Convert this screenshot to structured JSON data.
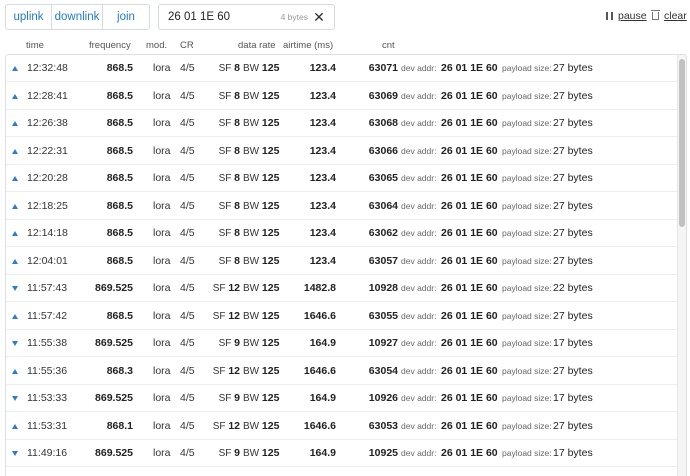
{
  "filters": {
    "uplink": "uplink",
    "downlink": "downlink",
    "join": "join"
  },
  "search": {
    "value": "26 01 1E 60",
    "match_count": "4 bytes",
    "clear_glyph": "✕"
  },
  "controls": {
    "pause_label": "pause",
    "clear_label": "clear"
  },
  "columns": {
    "time": "time",
    "frequency": "frequency",
    "modulation": "mod.",
    "coding_rate": "CR",
    "data_rate": "data rate",
    "airtime": "airtime (ms)",
    "counter": "cnt"
  },
  "labels": {
    "dev_addr": "dev addr:",
    "payload_size": "payload size:",
    "sf": "SF",
    "bw": "BW"
  },
  "colors": {
    "accent": "#1f7bc4",
    "direction_icon": "#2b7fc8"
  },
  "rows": [
    {
      "direction": "up",
      "time": "12:32:48",
      "frequency": "868.5",
      "mod": "lora",
      "cr": "4/5",
      "sf": "8",
      "bw": "125",
      "airtime": "123.4",
      "cnt": "63071",
      "dev_addr": "26 01 1E 60",
      "payload": "27 bytes"
    },
    {
      "direction": "up",
      "time": "12:28:41",
      "frequency": "868.5",
      "mod": "lora",
      "cr": "4/5",
      "sf": "8",
      "bw": "125",
      "airtime": "123.4",
      "cnt": "63069",
      "dev_addr": "26 01 1E 60",
      "payload": "27 bytes"
    },
    {
      "direction": "up",
      "time": "12:26:38",
      "frequency": "868.5",
      "mod": "lora",
      "cr": "4/5",
      "sf": "8",
      "bw": "125",
      "airtime": "123.4",
      "cnt": "63068",
      "dev_addr": "26 01 1E 60",
      "payload": "27 bytes"
    },
    {
      "direction": "up",
      "time": "12:22:31",
      "frequency": "868.5",
      "mod": "lora",
      "cr": "4/5",
      "sf": "8",
      "bw": "125",
      "airtime": "123.4",
      "cnt": "63066",
      "dev_addr": "26 01 1E 60",
      "payload": "27 bytes"
    },
    {
      "direction": "up",
      "time": "12:20:28",
      "frequency": "868.5",
      "mod": "lora",
      "cr": "4/5",
      "sf": "8",
      "bw": "125",
      "airtime": "123.4",
      "cnt": "63065",
      "dev_addr": "26 01 1E 60",
      "payload": "27 bytes"
    },
    {
      "direction": "up",
      "time": "12:18:25",
      "frequency": "868.5",
      "mod": "lora",
      "cr": "4/5",
      "sf": "8",
      "bw": "125",
      "airtime": "123.4",
      "cnt": "63064",
      "dev_addr": "26 01 1E 60",
      "payload": "27 bytes"
    },
    {
      "direction": "up",
      "time": "12:14:18",
      "frequency": "868.5",
      "mod": "lora",
      "cr": "4/5",
      "sf": "8",
      "bw": "125",
      "airtime": "123.4",
      "cnt": "63062",
      "dev_addr": "26 01 1E 60",
      "payload": "27 bytes"
    },
    {
      "direction": "up",
      "time": "12:04:01",
      "frequency": "868.5",
      "mod": "lora",
      "cr": "4/5",
      "sf": "8",
      "bw": "125",
      "airtime": "123.4",
      "cnt": "63057",
      "dev_addr": "26 01 1E 60",
      "payload": "27 bytes"
    },
    {
      "direction": "down",
      "time": "11:57:43",
      "frequency": "869.525",
      "mod": "lora",
      "cr": "4/5",
      "sf": "12",
      "bw": "125",
      "airtime": "1482.8",
      "cnt": "10928",
      "dev_addr": "26 01 1E 60",
      "payload": "22 bytes"
    },
    {
      "direction": "up",
      "time": "11:57:42",
      "frequency": "868.5",
      "mod": "lora",
      "cr": "4/5",
      "sf": "12",
      "bw": "125",
      "airtime": "1646.6",
      "cnt": "63055",
      "dev_addr": "26 01 1E 60",
      "payload": "27 bytes"
    },
    {
      "direction": "down",
      "time": "11:55:38",
      "frequency": "869.525",
      "mod": "lora",
      "cr": "4/5",
      "sf": "9",
      "bw": "125",
      "airtime": "164.9",
      "cnt": "10927",
      "dev_addr": "26 01 1E 60",
      "payload": "17 bytes"
    },
    {
      "direction": "up",
      "time": "11:55:36",
      "frequency": "868.3",
      "mod": "lora",
      "cr": "4/5",
      "sf": "12",
      "bw": "125",
      "airtime": "1646.6",
      "cnt": "63054",
      "dev_addr": "26 01 1E 60",
      "payload": "27 bytes"
    },
    {
      "direction": "down",
      "time": "11:53:33",
      "frequency": "869.525",
      "mod": "lora",
      "cr": "4/5",
      "sf": "9",
      "bw": "125",
      "airtime": "164.9",
      "cnt": "10926",
      "dev_addr": "26 01 1E 60",
      "payload": "17 bytes"
    },
    {
      "direction": "up",
      "time": "11:53:31",
      "frequency": "868.1",
      "mod": "lora",
      "cr": "4/5",
      "sf": "12",
      "bw": "125",
      "airtime": "1646.6",
      "cnt": "63053",
      "dev_addr": "26 01 1E 60",
      "payload": "27 bytes"
    },
    {
      "direction": "down",
      "time": "11:49:16",
      "frequency": "869.525",
      "mod": "lora",
      "cr": "4/5",
      "sf": "9",
      "bw": "125",
      "airtime": "164.9",
      "cnt": "10925",
      "dev_addr": "26 01 1E 60",
      "payload": "17 bytes"
    }
  ]
}
